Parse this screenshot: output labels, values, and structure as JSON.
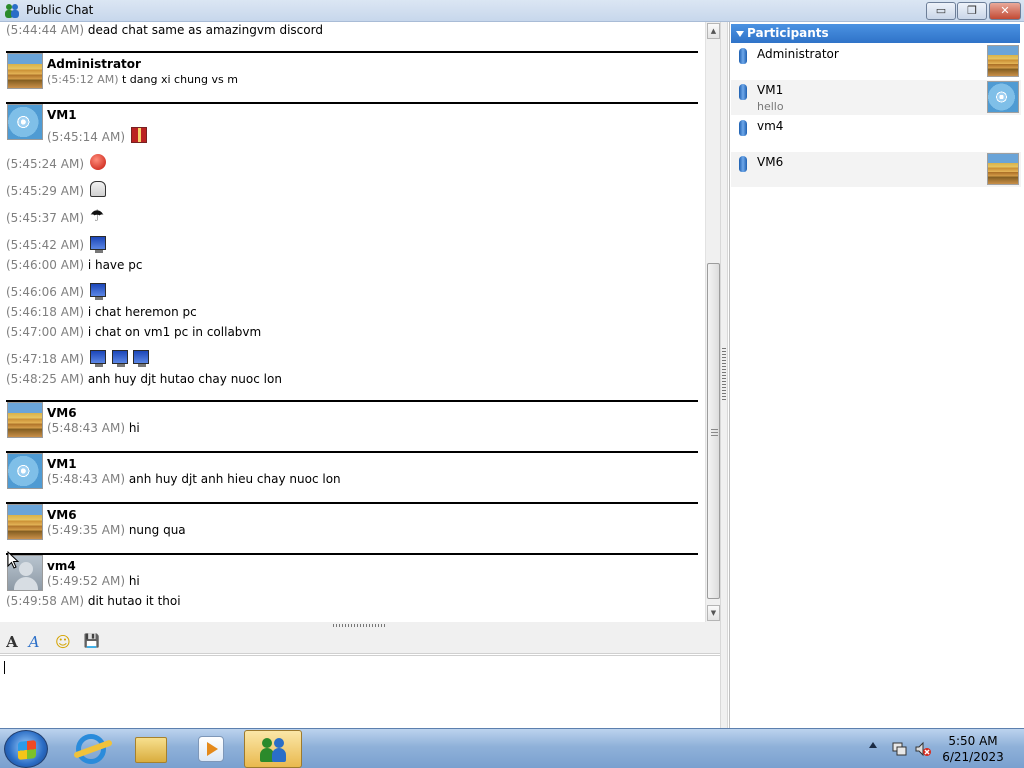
{
  "window": {
    "title": "Public Chat",
    "minimize_label": "▭",
    "restore_label": "❐",
    "close_label": "✕"
  },
  "chat": {
    "top_line": {
      "ts": "(5:44:44 AM)",
      "text": "dead chat same as amazingvm discord"
    },
    "blocks": [
      {
        "user": "Administrator",
        "avatar": "stairs-avatar",
        "lines": [
          {
            "ts": "(5:45:12 AM)",
            "text": "t dang xi chung vs m",
            "small": true
          }
        ]
      },
      {
        "user": "VM1",
        "avatar": "wheel-avatar",
        "lines": [
          {
            "ts": "(5:45:14 AM)",
            "text": "",
            "emoticons": [
              "gift-icon"
            ]
          },
          {
            "ts": "(5:45:24 AM)",
            "text": "",
            "emoticons": [
              "angry-face-icon"
            ]
          },
          {
            "ts": "(5:45:29 AM)",
            "text": "",
            "emoticons": [
              "sheep-icon"
            ]
          },
          {
            "ts": "(5:45:37 AM)",
            "text": "",
            "emoticons": [
              "umbrella-icon"
            ]
          },
          {
            "ts": "(5:45:42 AM)",
            "text": "",
            "emoticons": [
              "computer-icon"
            ]
          },
          {
            "ts": "(5:46:00 AM)",
            "text": "i have pc"
          },
          {
            "ts": "(5:46:06 AM)",
            "text": "",
            "emoticons": [
              "computer-icon"
            ]
          },
          {
            "ts": "(5:46:18 AM)",
            "text": "i chat heremon pc"
          },
          {
            "ts": "(5:47:00 AM)",
            "text": "i chat  on vm1 pc in collabvm"
          },
          {
            "ts": "(5:47:18 AM)",
            "text": "",
            "emoticons": [
              "computer-icon",
              "computer-icon",
              "computer-icon"
            ]
          },
          {
            "ts": "(5:48:25 AM)",
            "text": "anh huy djt hutao chay nuoc lon"
          }
        ]
      },
      {
        "user": "VM6",
        "avatar": "stairs-avatar",
        "lines": [
          {
            "ts": "(5:48:43 AM)",
            "text": "hi"
          }
        ]
      },
      {
        "user": "VM1",
        "avatar": "wheel-avatar",
        "lines": [
          {
            "ts": "(5:48:43 AM)",
            "text": "anh huy djt anh hieu chay nuoc lon"
          }
        ]
      },
      {
        "user": "VM6",
        "avatar": "stairs-avatar",
        "lines": [
          {
            "ts": "(5:49:35 AM)",
            "text": "nung qua"
          }
        ]
      },
      {
        "user": "vm4",
        "avatar": "default-user-avatar",
        "lines": [
          {
            "ts": "(5:49:52 AM)",
            "text": "hi"
          },
          {
            "ts": "(5:49:58 AM)",
            "text": "dit hutao it thoi"
          }
        ]
      }
    ]
  },
  "toolbar": {
    "font_label": "A",
    "font_color_label": "A",
    "emoticon_label": "☺",
    "save_label": "💾"
  },
  "input": {
    "value": ""
  },
  "participants": {
    "header": "Participants",
    "items": [
      {
        "name": "Administrator",
        "message": "",
        "avatar": "stairs-avatar"
      },
      {
        "name": "VM1",
        "message": "hello",
        "avatar": "wheel-avatar"
      },
      {
        "name": "vm4",
        "message": "",
        "avatar": ""
      },
      {
        "name": "VM6",
        "message": "",
        "avatar": "stairs-avatar"
      }
    ]
  },
  "taskbar": {
    "apps": [
      "internet-explorer-icon",
      "windows-explorer-icon",
      "media-player-icon",
      "windows-live-messenger-icon"
    ],
    "active_app": "windows-live-messenger-icon",
    "clock_time": "5:50 AM",
    "clock_date": "6/21/2023"
  },
  "colors": {
    "timestamp": "#7f7f7f",
    "participants_header": "#2f73c8",
    "active_taskbar_button": "#e9b94e"
  }
}
